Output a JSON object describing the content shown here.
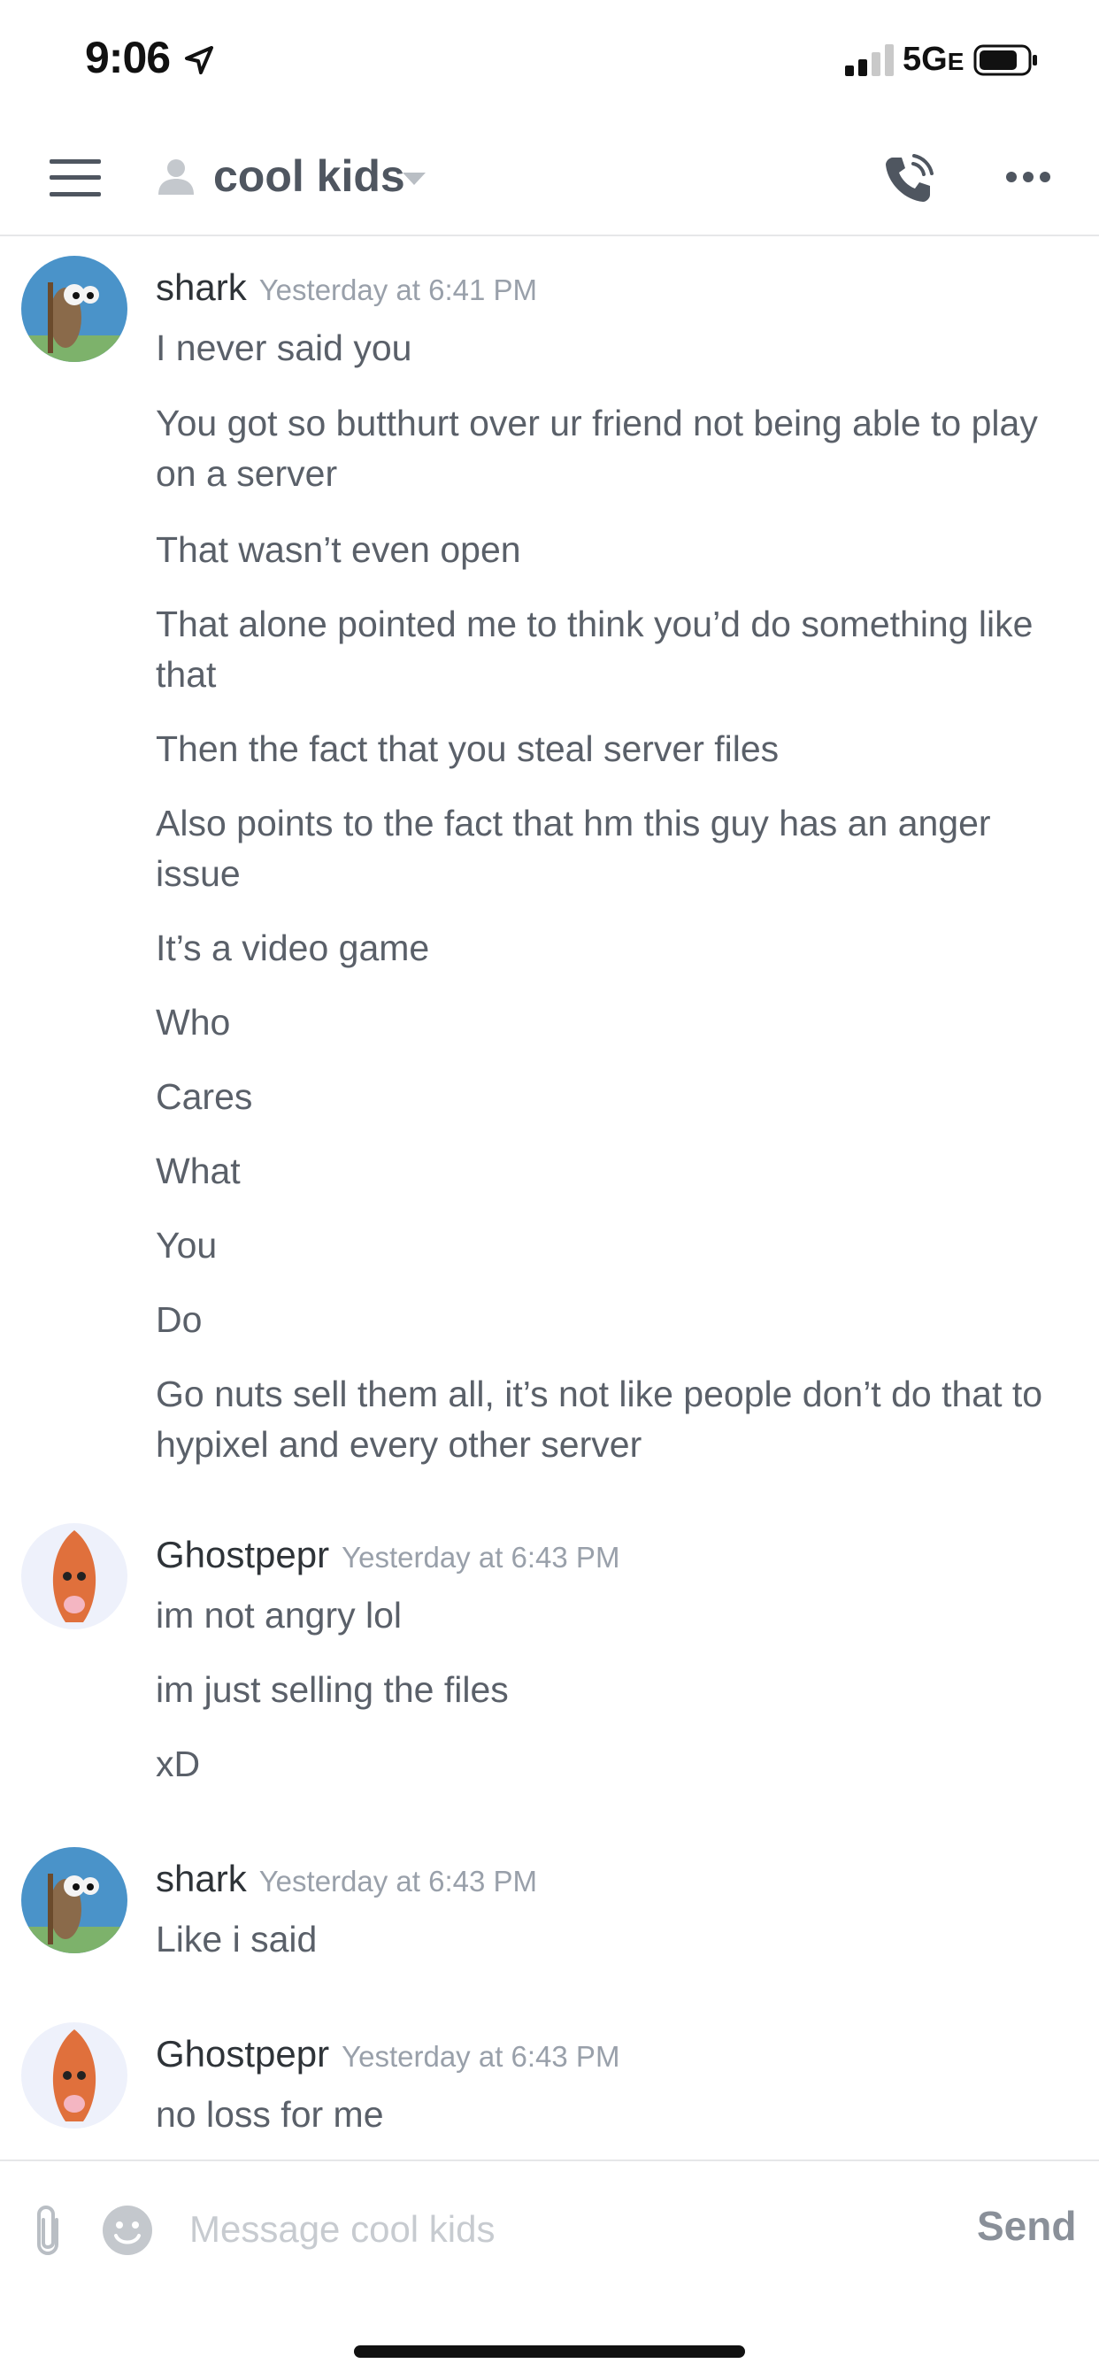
{
  "status_bar": {
    "time": "9:06",
    "network": "5G",
    "network_suffix": "E"
  },
  "header": {
    "channel_name": "cool kids"
  },
  "messages": [
    {
      "author": "shark",
      "timestamp": "Yesterday at 6:41 PM",
      "lines": [
        "I never said you",
        "You got so butthurt over ur friend not being able to play on a server",
        "That wasn’t even open",
        "That alone pointed me to think you’d do something like that",
        "Then the fact that you steal server files",
        "Also points to the fact that hm this guy has an anger issue",
        "It’s a video game",
        "Who",
        "Cares",
        "What",
        "You",
        "Do",
        "Go nuts sell them all, it’s not like people don’t do that to hypixel and every other server"
      ]
    },
    {
      "author": "Ghostpepr",
      "timestamp": "Yesterday at 6:43 PM",
      "lines": [
        "im not angry lol",
        "im just selling the files",
        "xD"
      ]
    },
    {
      "author": "shark",
      "timestamp": "Yesterday at 6:43 PM",
      "lines": [
        "Like i said"
      ]
    },
    {
      "author": "Ghostpepr",
      "timestamp": "Yesterday at 6:43 PM",
      "lines": [
        "no loss for me"
      ]
    }
  ],
  "composer": {
    "placeholder": "Message cool kids",
    "send_label": "Send"
  },
  "colors": {
    "text": "#5a6069",
    "author": "#2e3338",
    "timestamp": "#99a0aa",
    "divider": "#e6e7e9"
  }
}
